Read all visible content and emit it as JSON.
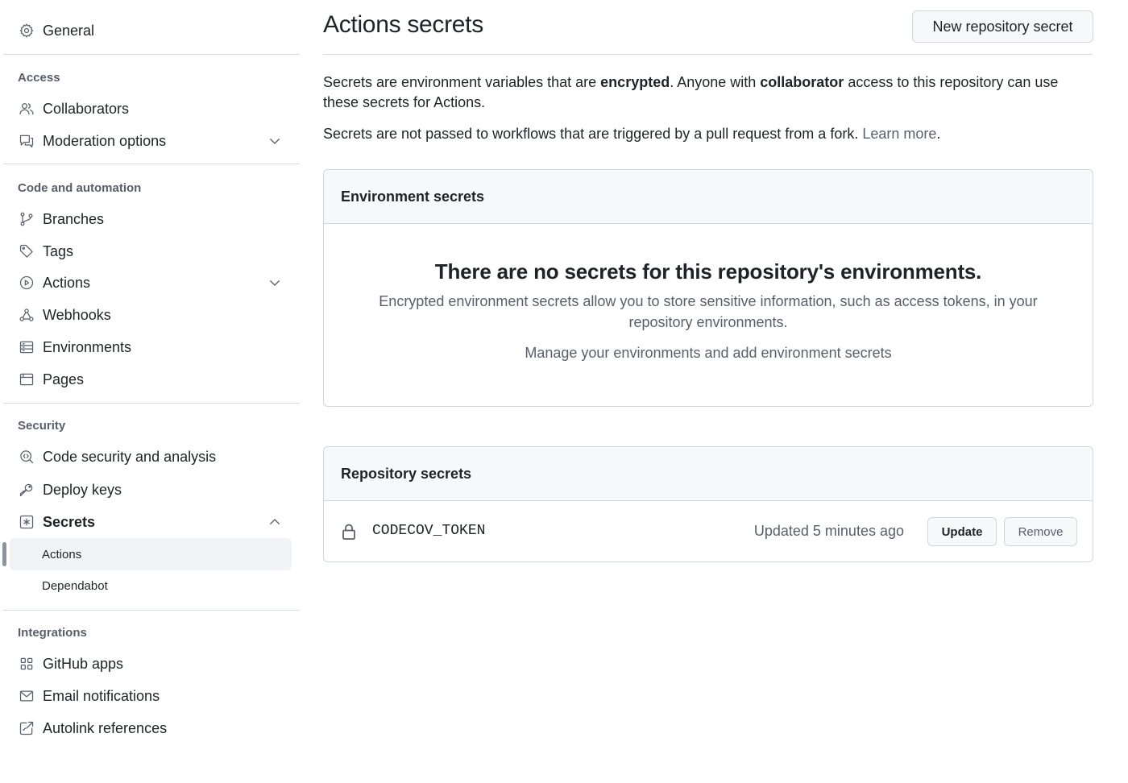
{
  "sidebar": {
    "general": {
      "label": "General",
      "icon": "gear-icon"
    },
    "sections": [
      {
        "heading": "Access"
      },
      {
        "heading": "Code and automation"
      },
      {
        "heading": "Security"
      },
      {
        "heading": "Integrations"
      }
    ],
    "items": {
      "collaborators": "Collaborators",
      "moderation": "Moderation options",
      "branches": "Branches",
      "tags": "Tags",
      "actions": "Actions",
      "webhooks": "Webhooks",
      "environments": "Environments",
      "pages": "Pages",
      "code_security": "Code security and analysis",
      "deploy_keys": "Deploy keys",
      "secrets": "Secrets",
      "secrets_actions": "Actions",
      "secrets_dependabot": "Dependabot",
      "github_apps": "GitHub apps",
      "email_notifications": "Email notifications",
      "autolink": "Autolink references"
    }
  },
  "main": {
    "title": "Actions secrets",
    "new_secret_button": "New repository secret",
    "intro": {
      "part1": "Secrets are environment variables that are ",
      "bold1": "encrypted",
      "part2": ". Anyone with ",
      "bold2": "collaborator",
      "part3": " access to this repository can use these secrets for Actions."
    },
    "fork_note": {
      "text": "Secrets are not passed to workflows that are triggered by a pull request from a fork. ",
      "link": "Learn more",
      "end": "."
    },
    "environment_secrets": {
      "heading": "Environment secrets",
      "blank_title": "There are no secrets for this repository's environments.",
      "blank_desc": "Encrypted environment secrets allow you to store sensitive information, such as access tokens, in your repository environments.",
      "manage_text": "Manage your environments and add environment secrets"
    },
    "repository_secrets": {
      "heading": "Repository secrets",
      "rows": [
        {
          "name": "CODECOV_TOKEN",
          "updated": "Updated 5 minutes ago",
          "update_label": "Update",
          "remove_label": "Remove"
        }
      ]
    }
  },
  "colors": {
    "text": "#1f2328",
    "muted": "#57606a",
    "border": "#d0d7de",
    "subtle_bg": "#f6f8fa"
  }
}
